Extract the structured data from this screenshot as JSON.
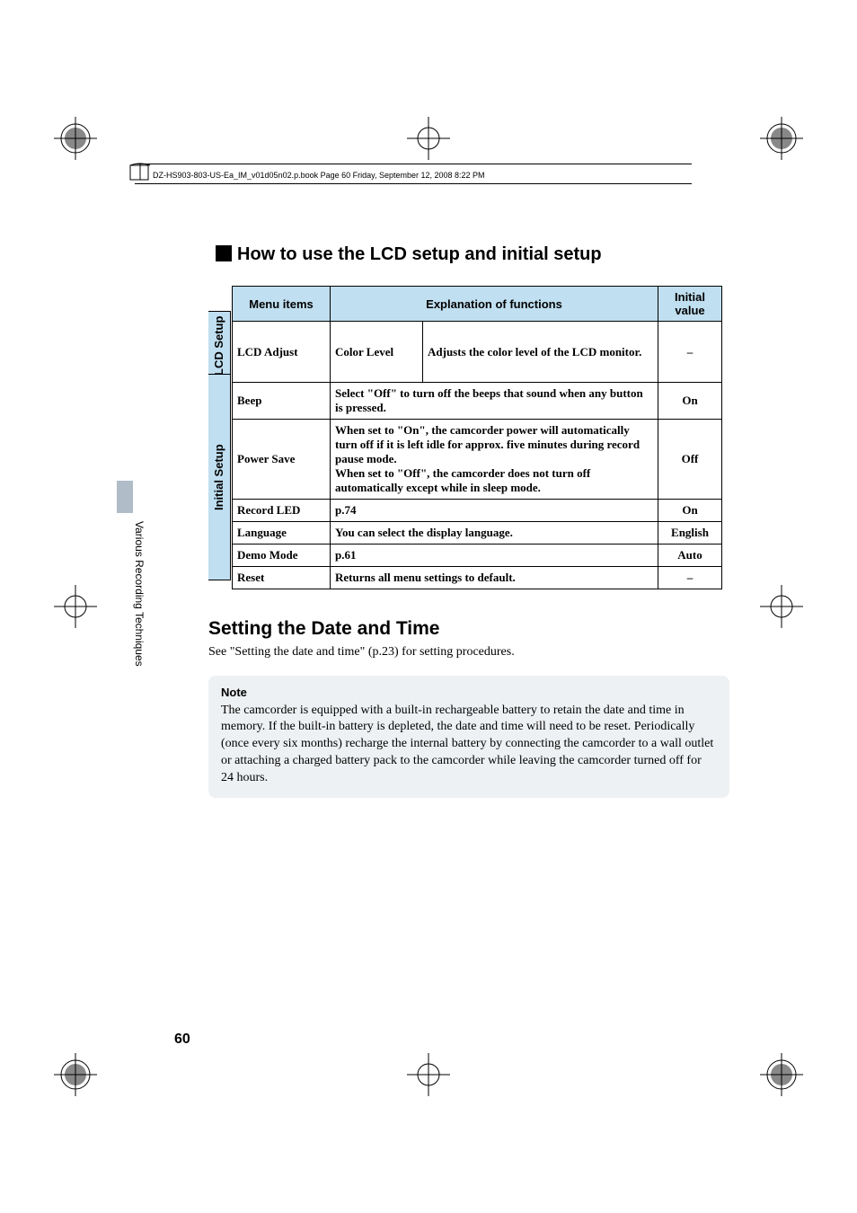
{
  "header": "DZ-HS903-803-US-Ea_IM_v01d05n02.p.book  Page 60  Friday, September 12, 2008  8:22 PM",
  "section_title": "How to use the LCD setup and initial setup",
  "table": {
    "h1": "Menu items",
    "h2": "Explanation of functions",
    "h3": "Initial value",
    "lcd_tab": "LCD Setup",
    "init_tab": "Initial Setup",
    "rows": {
      "lcd": {
        "item": "LCD Adjust",
        "sub": "Color Level",
        "func": "Adjusts the color level of the LCD monitor.",
        "val": "–"
      },
      "beep": {
        "item": "Beep",
        "func": "Select \"Off\" to turn off the beeps that sound when any button is pressed.",
        "val": "On"
      },
      "power": {
        "item": "Power Save",
        "func": "When set to \"On\", the camcorder power will automatically turn off if it is left idle for approx. five minutes during record pause mode.\nWhen set to \"Off\", the camcorder does not turn off automatically except while in sleep mode.",
        "val": "Off"
      },
      "rec": {
        "item": "Record LED",
        "func": "p.74",
        "val": "On"
      },
      "lang": {
        "item": "Language",
        "func": "You can select the display language.",
        "val": "English"
      },
      "demo": {
        "item": "Demo Mode",
        "func": "p.61",
        "val": "Auto"
      },
      "reset": {
        "item": "Reset",
        "func": "Returns all menu settings to default.",
        "val": "–"
      }
    }
  },
  "side_text": "Various Recording Techniques",
  "h2": "Setting the Date and Time",
  "body1": "See \"Setting the date and time\" (p.23) for setting procedures.",
  "note_title": "Note",
  "note_body": "The camcorder is equipped with a built-in rechargeable battery to retain the date and time in memory. If the built-in battery is depleted, the date and time will need to be reset. Periodically (once every six months) recharge the internal battery by connecting the camcorder to a wall outlet or attaching a charged battery pack to the camcorder while leaving the camcorder turned off for 24 hours.",
  "page_number": "60"
}
